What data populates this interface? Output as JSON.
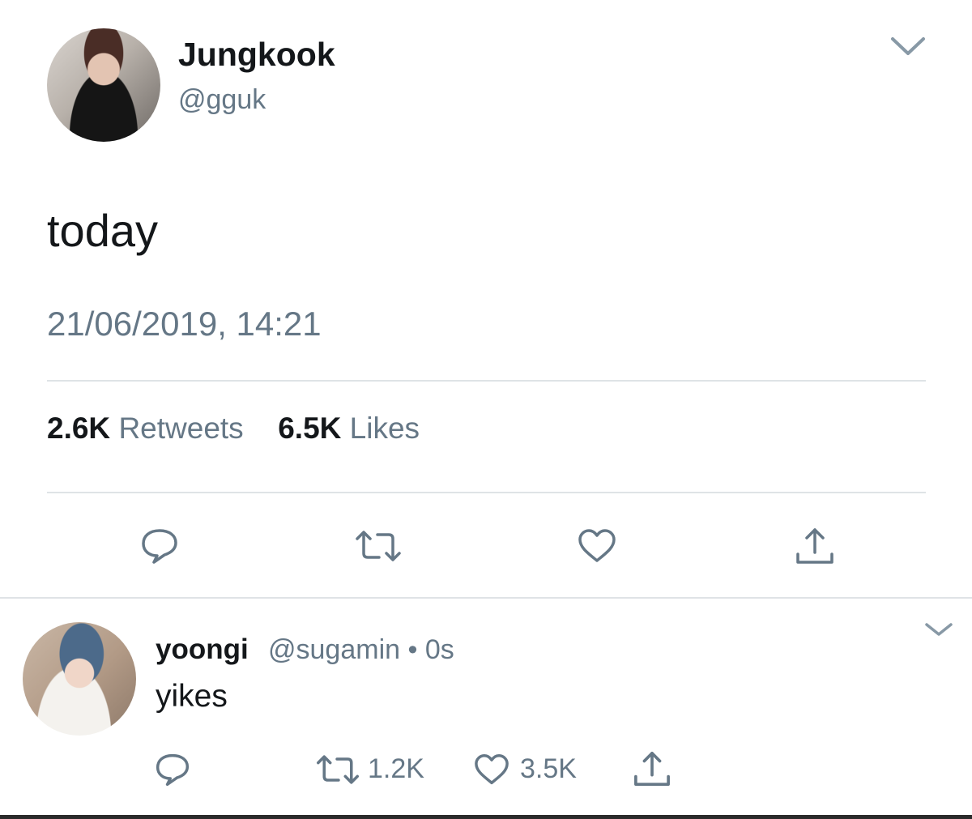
{
  "tweet": {
    "display_name": "Jungkook",
    "handle": "@gguk",
    "text": "today",
    "timestamp": "21/06/2019, 14:21",
    "retweets_count": "2.6K",
    "retweets_label": "Retweets",
    "likes_count": "6.5K",
    "likes_label": "Likes",
    "icons": [
      "chevron-down-icon",
      "reply-icon",
      "retweet-icon",
      "like-icon",
      "share-icon"
    ]
  },
  "reply": {
    "display_name": "yoongi",
    "meta": "@sugamin • 0s",
    "text": "yikes",
    "retweets_count": "1.2K",
    "likes_count": "3.5K",
    "icons": [
      "chevron-down-icon",
      "reply-icon",
      "retweet-icon",
      "like-icon",
      "share-icon"
    ]
  },
  "colors": {
    "text_primary": "#14171a",
    "text_secondary": "#657786",
    "divider": "#dfe3e6",
    "icon": "#657786"
  }
}
